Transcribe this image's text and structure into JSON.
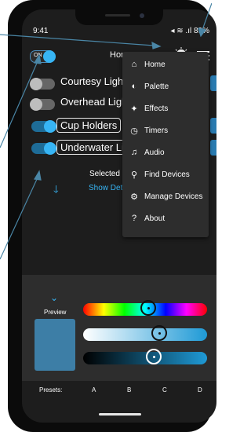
{
  "status": {
    "time": "9:41",
    "right": "◂ ≋ .ıl 89%"
  },
  "header": {
    "title": "Home",
    "master_label": "ON"
  },
  "devices": [
    {
      "name": "Courtesy Lights",
      "on": false
    },
    {
      "name": "Overhead Lights",
      "on": false
    },
    {
      "name": "Cup Holders",
      "on": true
    },
    {
      "name": "Underwater Lights",
      "on": true
    }
  ],
  "selection": {
    "selected_text": "Selected",
    "show_details": "Show Details"
  },
  "menu": [
    {
      "label": "Home",
      "icon": "home-icon",
      "glyph": "⌂"
    },
    {
      "label": "Palette",
      "icon": "palette-icon",
      "glyph": "◐"
    },
    {
      "label": "Effects",
      "icon": "effects-icon",
      "glyph": "✦"
    },
    {
      "label": "Timers",
      "icon": "timer-icon",
      "glyph": "◷"
    },
    {
      "label": "Audio",
      "icon": "music-icon",
      "glyph": "♫"
    },
    {
      "label": "Find Devices",
      "icon": "search-icon",
      "glyph": "⚲"
    },
    {
      "label": "Manage Devices",
      "icon": "gear-icon",
      "glyph": "⚙"
    },
    {
      "label": "About",
      "icon": "question-icon",
      "glyph": "?"
    }
  ],
  "color_panel": {
    "preview_label": "Preview",
    "preview_color": "#3d7ea6",
    "hue_level": 0.53,
    "saturation_level": 0.63,
    "brightness_level": 0.58
  },
  "presets": {
    "label": "Presets:",
    "items": [
      "A",
      "B",
      "C",
      "D"
    ]
  },
  "colors": {
    "accent": "#37b5f5",
    "background": "#1d1d1d",
    "menu": "#2d2d2d"
  }
}
